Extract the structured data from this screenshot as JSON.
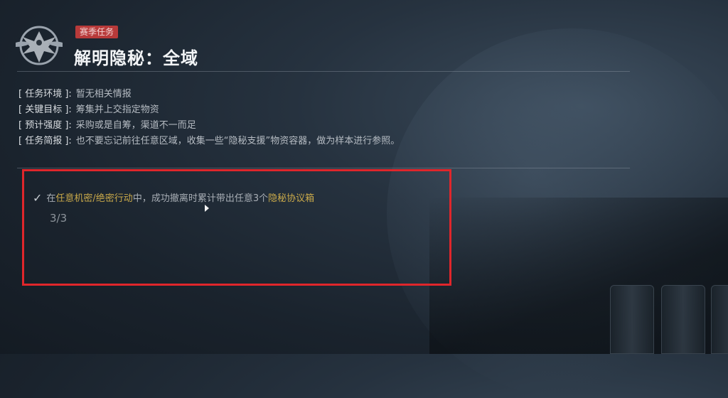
{
  "mission": {
    "tag": "赛季任务",
    "title": "解明隐秘：全域",
    "info": [
      {
        "key": "[ 任务环境 ]:",
        "value": "暂无相关情报"
      },
      {
        "key": "[ 关键目标 ]:",
        "value": "筹集并上交指定物资"
      },
      {
        "key": "[ 预计强度 ]:",
        "value": "采购或是自筹，渠道不一而足"
      },
      {
        "key": "[ 任务简报 ]:",
        "value": "也不要忘记前往任意区域，收集一些“隐秘支援”物资容器，做为样本进行参照。"
      }
    ],
    "objective": {
      "prefix": "在",
      "highlight1": "任意机密/绝密行动",
      "middle": "中，成功撤离时累计带出任意3个",
      "highlight2": "隐秘协议箱",
      "progress": "3/3",
      "completed": true
    }
  },
  "colors": {
    "tag_bg": "#b83a3a",
    "highlight_text": "#c9a94a",
    "annotation_box": "#e0262b"
  },
  "icons": {
    "emblem": "eagle-emblem-icon",
    "check": "checkmark-icon",
    "cursor": "mouse-cursor-icon"
  }
}
